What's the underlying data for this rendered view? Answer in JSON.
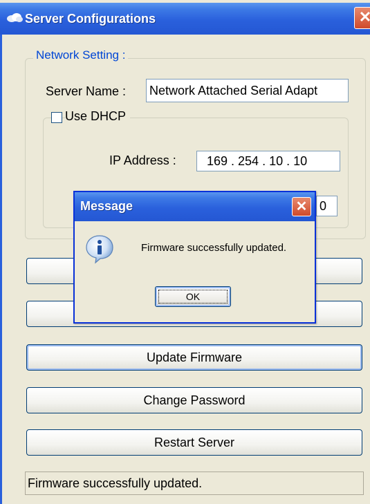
{
  "window": {
    "title": "Server Configurations",
    "close_glyph": "✕",
    "title_icon": "cloud-icon"
  },
  "network": {
    "legend": "Network Setting :",
    "server_name_label": "Server Name :",
    "server_name_value": "Network Attached Serial Adapt",
    "use_dhcp_label": "Use DHCP",
    "use_dhcp_checked": false,
    "ip_address_label": "IP Address :",
    "ip_address_value": "169 . 254 . 10 . 10",
    "second_field_visible_value": "0"
  },
  "buttons": {
    "update_firmware": "Update Firmware",
    "change_password": "Change Password",
    "restart_server": "Restart Server"
  },
  "status": {
    "text": "Firmware successfully updated."
  },
  "message_dialog": {
    "title": "Message",
    "close_glyph": "✕",
    "icon": "info-icon",
    "icon_glyph": "i",
    "text": "Firmware successfully updated.",
    "ok_label": "OK"
  },
  "colors": {
    "titlebar": "#2a60dc",
    "legend_text": "#0046d5",
    "window_bg": "#ece9d8",
    "close_button": "#cf4a2b"
  }
}
